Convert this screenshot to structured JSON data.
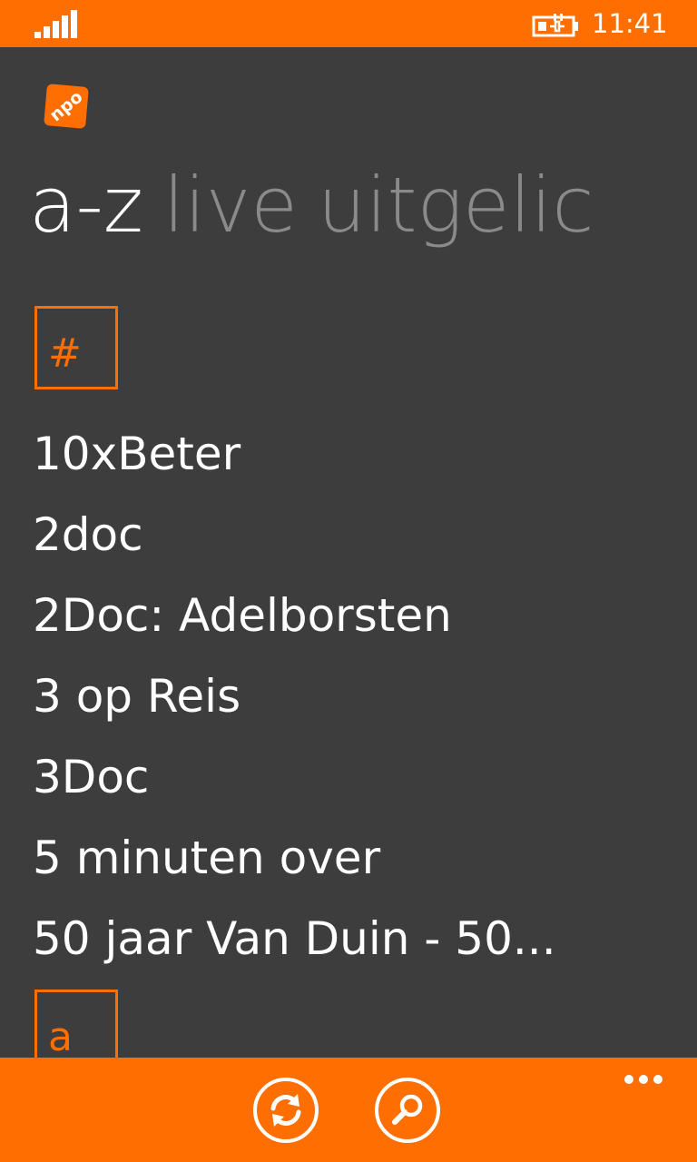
{
  "status_bar": {
    "time": "11:41",
    "icons": [
      "signal-strength-icon",
      "battery-charging-icon"
    ],
    "background_color": "#ff6e00"
  },
  "logo": {
    "text": "npo",
    "icon": "npo-logo-icon",
    "color": "#ff6e00"
  },
  "pivot": {
    "items": [
      {
        "label": "a-z",
        "active": true
      },
      {
        "label": "live",
        "active": false
      },
      {
        "label": "uitgelic",
        "active": false
      }
    ]
  },
  "list": {
    "groups": [
      {
        "key": "#"
      },
      {
        "key": "a"
      }
    ],
    "items": [
      {
        "title": "10xBeter"
      },
      {
        "title": "2doc"
      },
      {
        "title": "2Doc: Adelborsten"
      },
      {
        "title": "3 op Reis"
      },
      {
        "title": "3Doc"
      },
      {
        "title": "5 minuten over"
      },
      {
        "title": "50 jaar Van Duin - 50..."
      }
    ]
  },
  "app_bar": {
    "buttons": [
      {
        "icon": "refresh-icon"
      },
      {
        "icon": "search-icon"
      }
    ],
    "more_icon": "more-dots-icon",
    "background_color": "#ff6e00"
  },
  "theme": {
    "accent": "#ff6e00",
    "background": "#3d3d3d",
    "inactive_text": "#8a8a8a"
  }
}
